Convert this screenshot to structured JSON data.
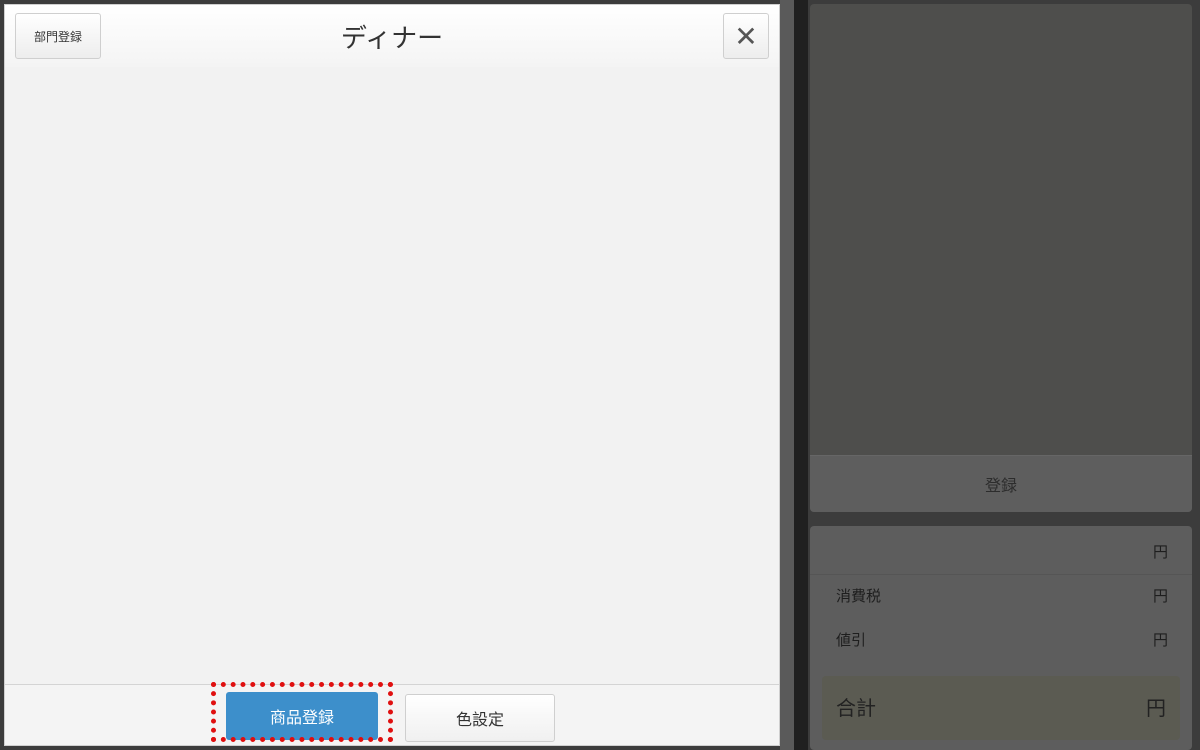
{
  "dialog": {
    "title": "ディナー",
    "dept_register_label": "部門登録",
    "close_glyph": "✕",
    "footer": {
      "product_register_label": "商品登録",
      "color_settings_label": "色設定"
    }
  },
  "right_panel": {
    "register_label": "登録",
    "summary": {
      "subtotal_unit": "円",
      "tax_label": "消費税",
      "tax_unit": "円",
      "discount_label": "値引",
      "discount_unit": "円",
      "total_label": "合計",
      "total_unit": "円"
    }
  },
  "colors": {
    "primary_button": "#3d8fcb",
    "highlight_border": "#e01010"
  }
}
